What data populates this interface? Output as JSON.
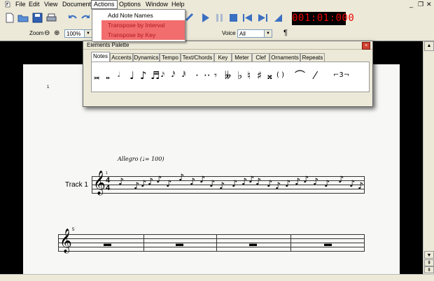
{
  "menubar": {
    "items": [
      "File",
      "Edit",
      "View",
      "Document",
      "Actions",
      "Options",
      "Window",
      "Help"
    ],
    "active": "Actions"
  },
  "actions_menu": {
    "items": [
      "Add Note Names",
      "Transpose by Interval",
      "Transpose by Key"
    ]
  },
  "toolbar": {
    "time_display": "001:01:000",
    "icons": [
      "new-document-icon",
      "open-folder-icon",
      "save-icon",
      "print-icon",
      "undo-icon",
      "redo-icon",
      "play-icon",
      "pause-icon",
      "stop-icon",
      "rewind-icon",
      "fast-forward-icon",
      "record-icon"
    ]
  },
  "toolbar2": {
    "zoom_label": "Zoom",
    "zoom_value": "100%",
    "voice_label": "Voice",
    "voice_value": "All",
    "paragraph_symbol": "¶"
  },
  "palette": {
    "title": "Elements Palette",
    "close_symbol": "×",
    "tabs": [
      "Notes",
      "Accents",
      "Dynamics",
      "Tempo",
      "Text/Chords",
      "Key",
      "Meter",
      "Clef",
      "Ornaments",
      "Repeats"
    ],
    "active_tab": "Notes",
    "glyphs": [
      "𝅜",
      "𝅝",
      "𝅗𝅥",
      "♩",
      "♪",
      "♬",
      "𝅘𝅥𝅯",
      "𝅘𝅥𝅰",
      "𝅘𝅥𝅱",
      "·",
      "··",
      "𝄾",
      "𝄫",
      "♭",
      "♮",
      "♯",
      "𝄪",
      "( )",
      "⌒",
      "⁄",
      "⌐3¬"
    ]
  },
  "score": {
    "page_number": "1",
    "tempo_text": "Allegro (♩= 100)",
    "track_name": "Track 1",
    "measure_number_1": "1",
    "measure_number_2": "5",
    "time_signature_top": "4",
    "time_signature_bottom": "4",
    "clef": "𝄞",
    "rest": "▬"
  },
  "colors": {
    "menu_highlight": "#f26d6d",
    "time_display_text": "#e00000"
  }
}
